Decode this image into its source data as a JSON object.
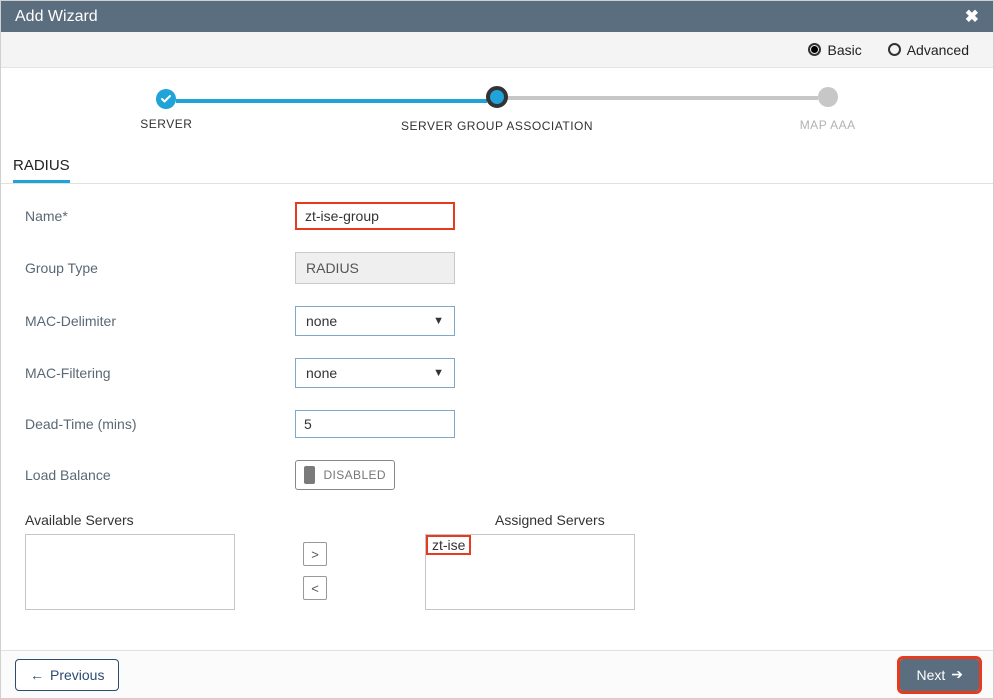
{
  "header": {
    "title": "Add Wizard"
  },
  "mode": {
    "basic": "Basic",
    "advanced": "Advanced",
    "selected": "basic"
  },
  "steps": {
    "s1": "SERVER",
    "s2": "SERVER GROUP ASSOCIATION",
    "s3": "MAP AAA"
  },
  "tab": {
    "label": "RADIUS"
  },
  "form": {
    "name_label": "Name*",
    "name_value": "zt-ise-group",
    "group_type_label": "Group Type",
    "group_type_value": "RADIUS",
    "mac_delim_label": "MAC-Delimiter",
    "mac_delim_value": "none",
    "mac_filter_label": "MAC-Filtering",
    "mac_filter_value": "none",
    "dead_time_label": "Dead-Time (mins)",
    "dead_time_value": "5",
    "load_balance_label": "Load Balance",
    "load_balance_state": "DISABLED"
  },
  "lists": {
    "available_title": "Available Servers",
    "assigned_title": "Assigned Servers",
    "assigned": [
      "zt-ise"
    ]
  },
  "footer": {
    "prev": "Previous",
    "next": "Next"
  }
}
